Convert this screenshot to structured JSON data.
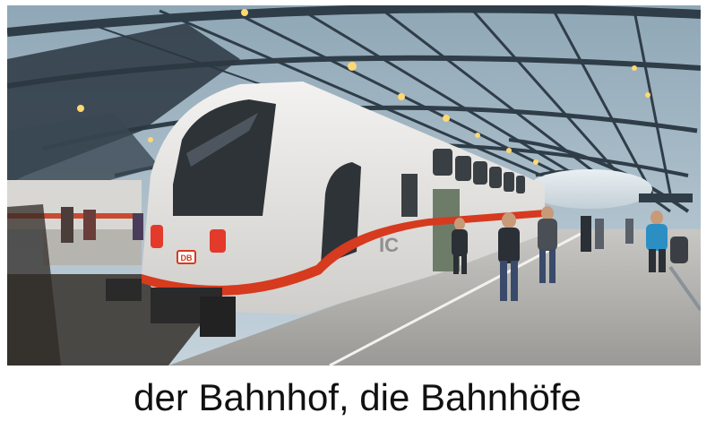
{
  "photo": {
    "subject": "intercity-train-at-station-platform",
    "train_logo_text": "DB",
    "train_class_text": "IC",
    "colors": {
      "roof_glass": "#9fb6c4",
      "roof_steel": "#2f3d48",
      "train_body": "#e9e8e6",
      "train_stripe": "#d63a1f",
      "platform": "#b9b8b4",
      "lights": "#ffd873"
    }
  },
  "caption": {
    "text": "der Bahnhof, die Bahnhöfe"
  }
}
